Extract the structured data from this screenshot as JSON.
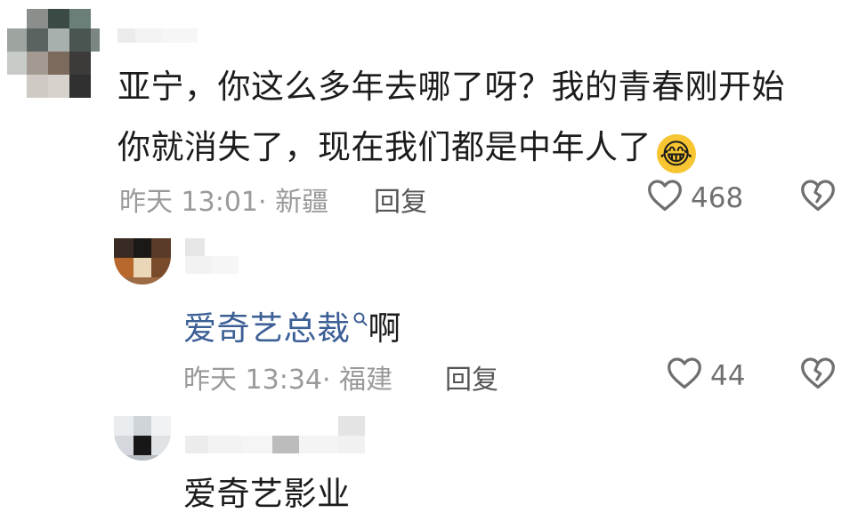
{
  "comments": [
    {
      "text_line1": "亚宁，你这么多年去哪了呀？我的青春刚开始",
      "text_line2": "你就消失了，现在我们都是中年人了",
      "emoji": "😂",
      "time": "昨天 13:01",
      "location": "· 新疆",
      "reply_label": "回复",
      "likes": "468",
      "dislike_icon": "heart-broken-icon",
      "like_icon": "heart-outline-icon"
    },
    {
      "mention": "爱奇艺总裁",
      "mention_icon": "search-icon",
      "text": "啊",
      "time": "昨天 13:34",
      "location": "· 福建",
      "reply_label": "回复",
      "likes": "44",
      "dislike_icon": "heart-broken-icon",
      "like_icon": "heart-outline-icon"
    },
    {
      "text": "爱奇艺影业"
    }
  ],
  "colors": {
    "mention": "#3c5f96",
    "meta": "#9a9a9a",
    "text": "#1c1c1c"
  }
}
